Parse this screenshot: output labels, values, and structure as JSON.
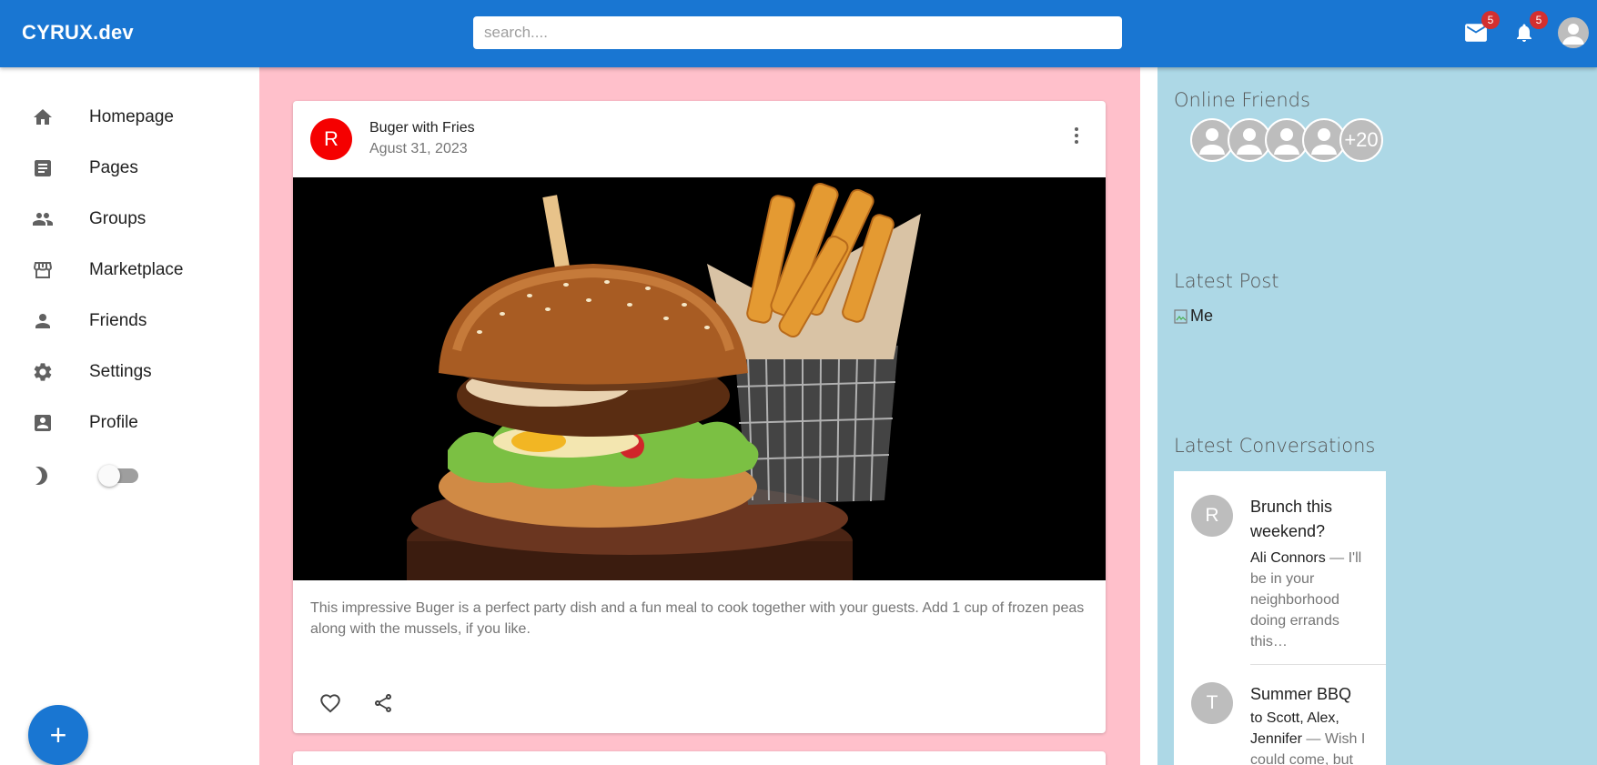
{
  "app": {
    "brand": "CYRUX.dev",
    "search_placeholder": "search....",
    "mail_badge": "5",
    "notifications_badge": "5",
    "colors": {
      "primary": "#1976d2",
      "feed_bg": "#ffc0cb",
      "rightbar_bg": "#add8e6",
      "badge": "#d32f2f"
    }
  },
  "sidebar": {
    "items": [
      {
        "label": "Homepage",
        "icon": "home-icon"
      },
      {
        "label": "Pages",
        "icon": "article-icon"
      },
      {
        "label": "Groups",
        "icon": "group-icon"
      },
      {
        "label": "Marketplace",
        "icon": "storefront-icon"
      },
      {
        "label": "Friends",
        "icon": "person-icon"
      },
      {
        "label": "Settings",
        "icon": "settings-icon"
      },
      {
        "label": "Profile",
        "icon": "account-box-icon"
      }
    ],
    "dark_mode_toggle": {
      "icon": "dark-mode-icon",
      "on": false
    },
    "fab_label": "+"
  },
  "feed": {
    "post": {
      "avatar_letter": "R",
      "title": "Buger with Fries",
      "date": "Agust 31, 2023",
      "text": "This impressive Buger is a perfect party dish and a fun meal to cook together with your guests. Add 1 cup of frozen peas along with the mussels, if you like."
    }
  },
  "rightbar": {
    "online_friends_title": "Online Friends",
    "more_friends": "+20",
    "latest_post_title": "Latest Post",
    "latest_post_alt": "Me",
    "latest_conversations_title": "Latest Conversations",
    "conversations": [
      {
        "avatar_letter": "R",
        "title": "Brunch this weekend?",
        "who": "Ali Connors",
        "snippet": " — I'll be in your neighborhood doing errands this…"
      },
      {
        "avatar_letter": "T",
        "title": "Summer BBQ",
        "who": "to Scott, Alex, Jennifer",
        "snippet": " — Wish I could come, but"
      }
    ]
  }
}
